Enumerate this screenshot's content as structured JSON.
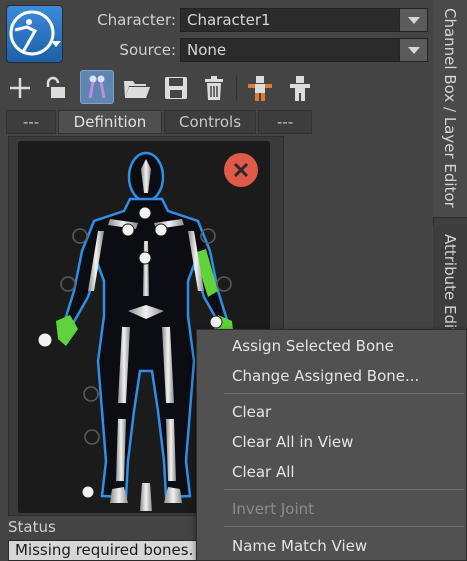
{
  "header": {
    "character_label": "Character:",
    "character_value": "Character1",
    "source_label": "Source:",
    "source_value": "None"
  },
  "toolbar": {
    "icons": [
      "add-icon",
      "lock-icon",
      "skeleton-tool-icon",
      "folder-open-icon",
      "save-icon",
      "trash-icon",
      "character-pose-icon",
      "character-pose-alt-icon"
    ]
  },
  "tabs": [
    {
      "label": "---"
    },
    {
      "label": "Definition",
      "active": true
    },
    {
      "label": "Controls"
    },
    {
      "label": "---"
    }
  ],
  "side_tabs": [
    {
      "label": "Channel Box / Layer Editor"
    },
    {
      "label": "Attribute Editor"
    }
  ],
  "status": {
    "label": "Status",
    "message": "Missing required bones."
  },
  "context_menu": {
    "items": [
      {
        "label": "Assign Selected Bone",
        "enabled": true
      },
      {
        "label": "Change Assigned Bone...",
        "enabled": true
      },
      {
        "label": "Clear",
        "enabled": true
      },
      {
        "label": "Clear All in View",
        "enabled": true
      },
      {
        "label": "Clear All",
        "enabled": true
      },
      {
        "label": "Invert Joint",
        "enabled": false
      },
      {
        "label": "Name Match View",
        "enabled": true
      }
    ]
  },
  "colors": {
    "accent_blue": "#2f8fe6",
    "bone_green": "#5fd23c",
    "close_red": "#e05a4a",
    "background": "#444444"
  }
}
